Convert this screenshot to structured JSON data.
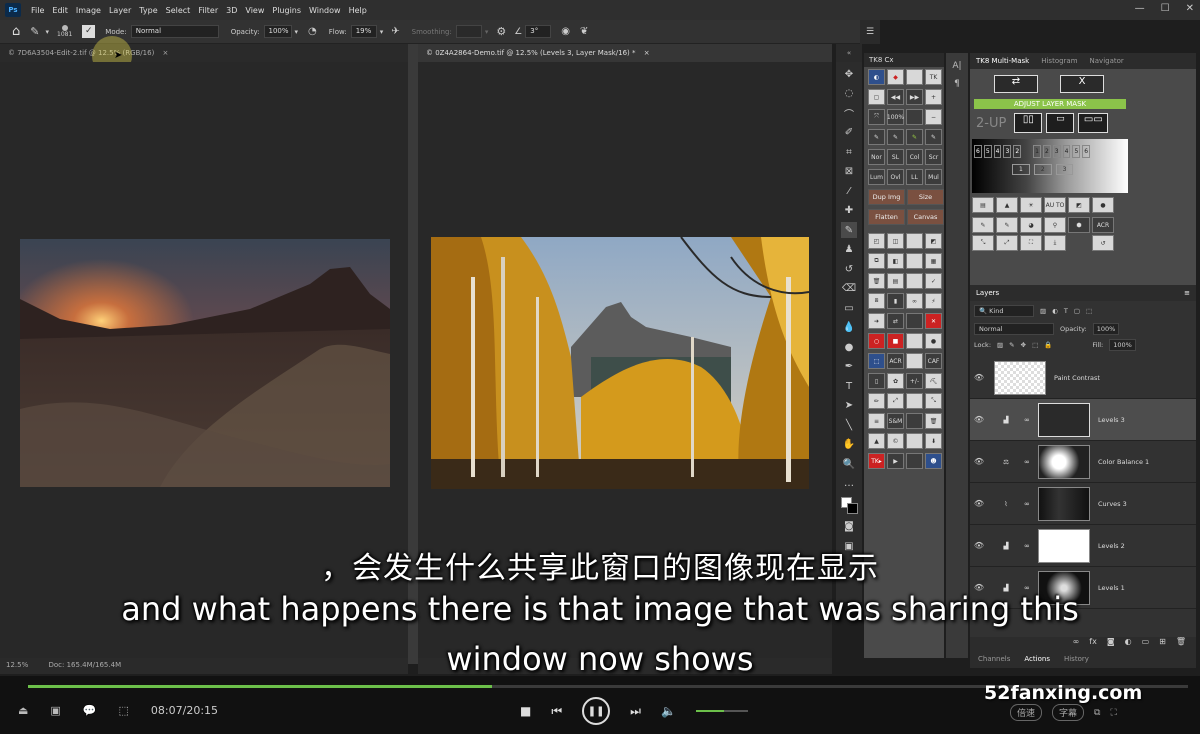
{
  "menubar": {
    "items": [
      "File",
      "Edit",
      "Image",
      "Layer",
      "Type",
      "Select",
      "Filter",
      "3D",
      "View",
      "Plugins",
      "Window",
      "Help"
    ]
  },
  "options": {
    "brush_size": "1081",
    "mode_label": "Mode:",
    "mode_value": "Normal",
    "opacity_label": "Opacity:",
    "opacity_value": "100%",
    "flow_label": "Flow:",
    "flow_value": "19%",
    "smoothing_label": "Smoothing:",
    "angle_value": "3°"
  },
  "docs": {
    "left_tab": "© 7D6A3504-Edit-2.tif @ 12.5% (RGB/16)",
    "right_tab": "© 0Z4A2864-Demo.tif @ 12.5% (Levels 3, Layer Mask/16) *",
    "zoom": "12.5%",
    "doc_info": "Doc: 165.4M/165.4M"
  },
  "tk8": {
    "title": "TK8 Cx",
    "row_blend": [
      "Nor",
      "SL",
      "Col",
      "Scr"
    ],
    "row_blend2": [
      "Lum",
      "Ovl",
      "LL",
      "Mul"
    ],
    "zoom_label": "100%",
    "dup_img": "Dup Img",
    "size": "Size",
    "flatten": "Flatten",
    "canvas": "Canvas",
    "acr": "ACR",
    "caf": "CAF",
    "plusminus": "+/-",
    "sm": "S&M",
    "tk": "TK"
  },
  "multimask": {
    "tabs": [
      "TK8 Multi-Mask",
      "Histogram",
      "Navigator"
    ],
    "x_label": "X",
    "adjust_label": "ADJUST LAYER MASK",
    "twoup": "2-UP",
    "zone_nums_dark": [
      "6",
      "5",
      "4",
      "3",
      "2"
    ],
    "zone_nums_light": [
      "1",
      "2",
      "3",
      "4",
      "5",
      "6"
    ],
    "zone_small": [
      "1",
      "2",
      "3"
    ],
    "auto_label": "AU TO",
    "acr_label": "ACR"
  },
  "layers": {
    "title": "Layers",
    "kind": "Kind",
    "blend_mode": "Normal",
    "opacity_label": "Opacity:",
    "opacity": "100%",
    "lock_label": "Lock:",
    "fill_label": "Fill:",
    "fill": "100%",
    "rows": [
      {
        "name": "Paint Contrast"
      },
      {
        "name": "Levels 3"
      },
      {
        "name": "Color Balance 1"
      },
      {
        "name": "Curves 3"
      },
      {
        "name": "Levels 2"
      },
      {
        "name": "Levels 1"
      }
    ]
  },
  "bottom_tabs": [
    "Channels",
    "Actions",
    "History"
  ],
  "subtitles": {
    "zh": "，会发生什么共享此窗口的图像现在显示",
    "en1": "and what happens there is that image that was sharing this",
    "en2": "window now shows"
  },
  "player": {
    "time": "08:07/20:15",
    "speed": "倍速",
    "subs": "字幕",
    "watermark": "52fanxing.com",
    "progress": 0.4
  }
}
